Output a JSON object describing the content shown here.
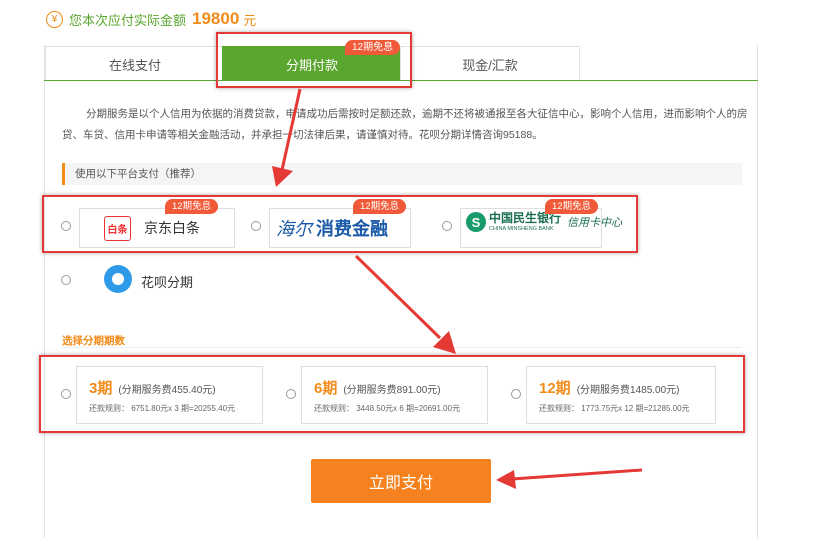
{
  "amount": {
    "icon": "yen-icon",
    "label": "您本次应付实际金额",
    "value": "19800",
    "unit": "元"
  },
  "tabs": [
    {
      "label": "在线支付",
      "active": false
    },
    {
      "label": "分期付款",
      "active": true,
      "badge": "12期免息"
    },
    {
      "label": "现金/汇款",
      "active": false
    }
  ],
  "description": "分期服务是以个人信用为依据的消费贷款，申请成功后需按时足额还款，逾期不还将被通报至各大征信中心，影响个人信用，进而影响个人的房贷、车贷、信用卡申请等相关金融活动，并承担一切法律后果，请谨慎对待。花呗分期详情咨询95188。",
  "platform_section": {
    "title": "使用以下平台支付（推荐）",
    "platforms": [
      {
        "name": "京东白条",
        "logo_text": "白条",
        "badge": "12期免息",
        "selected": false
      },
      {
        "name": "海尔消费金融",
        "logo_script": "海尔",
        "logo_text": "消费金融",
        "badge": "12期免息",
        "selected": false
      },
      {
        "name": "中国民生银行",
        "logo_en": "CHINA MINSHENG BANK",
        "logo_sub": "信用卡中心",
        "badge": "12期免息",
        "selected": false
      },
      {
        "name": "花呗分期",
        "selected": false
      }
    ]
  },
  "term_section": {
    "title": "选择分期期数",
    "terms": [
      {
        "period": "3期",
        "fee": "(分期服务费455.40元)",
        "rule": "还款规则：  6751.80元x 3 期=20255.40元"
      },
      {
        "period": "6期",
        "fee": "(分期服务费891.00元)",
        "rule": "还款规则：  3448.50元x 6 期=20691.00元"
      },
      {
        "period": "12期",
        "fee": "(分期服务费1485.00元)",
        "rule": "还款规则：  1773.75元x 12 期=21285.00元"
      }
    ]
  },
  "pay_button": {
    "label": "立即支付",
    "color": "#f5821f"
  },
  "colors": {
    "brand_green": "#5aa62f",
    "accent_orange": "#f28c1a",
    "badge_red": "#f05a38",
    "annotation_red": "#e53935"
  }
}
